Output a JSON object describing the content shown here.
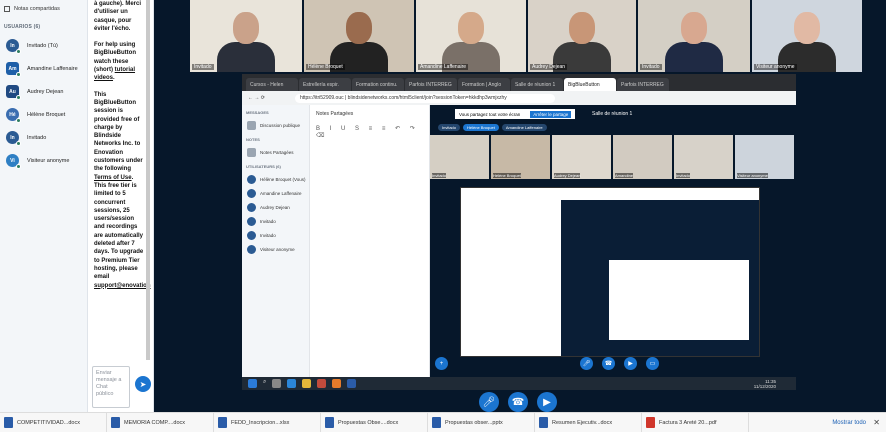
{
  "left_panel": {
    "notes_label": "Notas compartidas",
    "users_title": "USUARIOS (6)",
    "users": [
      {
        "initials": "In",
        "name": "Invitado (Tú)",
        "color": "#2b5b93"
      },
      {
        "initials": "Am",
        "name": "Amandine Laffenaire",
        "color": "#1e5fa8"
      },
      {
        "initials": "Au",
        "name": "Audrey Dejean",
        "color": "#204a82"
      },
      {
        "initials": "Hé",
        "name": "Hélène Broquet",
        "color": "#3a6db0"
      },
      {
        "initials": "In",
        "name": "Invitado",
        "color": "#2b5b93"
      },
      {
        "initials": "Vi",
        "name": "Visiteur anonyme",
        "color": "#2e7fc4"
      }
    ]
  },
  "chat": {
    "p1": "à gauche). Merci d'utiliser un casque, pour éviter l'écho.",
    "p2a": "For help using BigBlueButton watch these (short)",
    "p2_link": "tutorial videos",
    "p3a": "This BigBlueButton session is provided free of charge by Blindside Networks Inc. to Enovation customers under the following",
    "p3_link": "Terms of Use",
    "p3b": ". This free tier is limited to 5 concurrent sessions, 25 users/session and recordings are automatically deleted after 7 days. To upgrade to Premium Tier hosting, please email",
    "p3_email": "support@enovation",
    "input_placeholder": "Enviar mensaje a Chat público"
  },
  "video_tiles": [
    {
      "name": "Invitado"
    },
    {
      "name": "Hélène Broquet"
    },
    {
      "name": "Amandine Laffenaire"
    },
    {
      "name": "Audrey Dejean"
    },
    {
      "name": "Invitado"
    },
    {
      "name": "Visiteur anonyme"
    }
  ],
  "shared_screen": {
    "tabs": [
      "Cursos - Helen",
      "Estrellería espir.",
      "Formation continu.",
      "Parfois INTERREG",
      "Formation | Anglo",
      "Salle de réunion 1",
      "BigBlueButton",
      "Parfois INTERREG"
    ],
    "url": "https://itri52909.ouc | blindsidenetworks.com/html5client/join?sessionToken=hkkdhp3wmjxzhy",
    "left_sections": {
      "messages": "MESSAGES",
      "public_chat": "Discussion publique",
      "notes": "NOTES",
      "shared_notes": "Notes Partagées",
      "users": "UTILISATEURS (6)"
    },
    "left_users": [
      "Hélène Broquet (Vous)",
      "Amandine Laffenaire",
      "Audrey Dejean",
      "Invitado",
      "Invitado",
      "Visiteur anonyme"
    ],
    "notes_title": "Notes Partagées",
    "room_title": "Salle de réunion 1",
    "share_msg": "Vous partagez tout votre écran",
    "share_btn": "Arrêter le partage",
    "pills": [
      "Invitado",
      "Hélène Broquet",
      "Amandine Laffenaire"
    ],
    "inner_vids": [
      "Invitado",
      "Hélène Broquet",
      "Audrey Dejean",
      "Amandine",
      "Invitado",
      "Visiteur anonyme"
    ],
    "clock_time": "11:35",
    "clock_date": "11/12/2020"
  },
  "downloads": [
    {
      "name": "COMPETITIVIDAD...docx",
      "type": "doc"
    },
    {
      "name": "MEMORIA COMP....docx",
      "type": "doc"
    },
    {
      "name": "FEDD_Inscripcion...xlsx",
      "type": "doc"
    },
    {
      "name": "Propuestas Obse....docx",
      "type": "doc"
    },
    {
      "name": "Propuestas obser...pptx",
      "type": "doc"
    },
    {
      "name": "Resumen Ejecutiv...docx",
      "type": "doc"
    },
    {
      "name": "Factura 3 Areté 20...pdf",
      "type": "pdf"
    }
  ],
  "downloads_show_all": "Mostrar todo",
  "colors": {
    "primary": "#1b75d0",
    "dark_bg": "#06172a"
  }
}
